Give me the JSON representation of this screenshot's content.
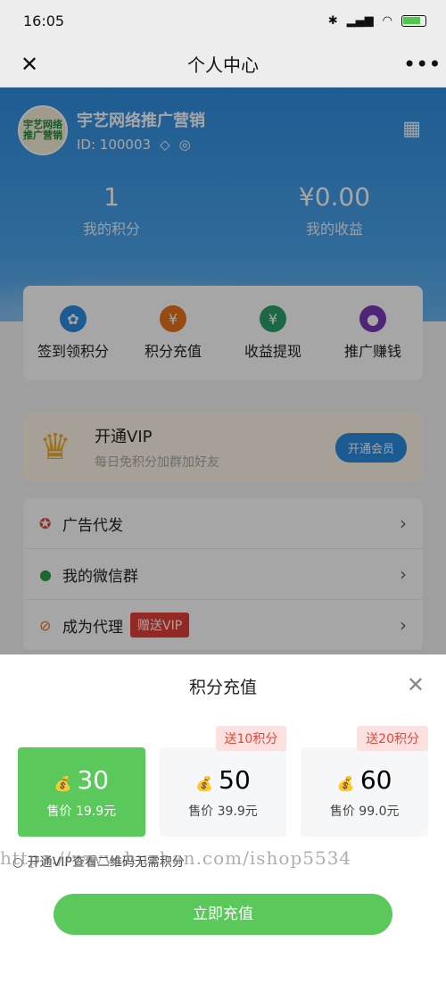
{
  "status": {
    "time": "16:05",
    "battery": "67"
  },
  "topbar": {
    "title": "个人中心"
  },
  "profile": {
    "name": "宇艺网络推广营销",
    "id": "ID: 100003",
    "avatar_text": "宇艺网络推广营销"
  },
  "stats": [
    {
      "value": "1",
      "label": "我的积分"
    },
    {
      "value": "¥0.00",
      "label": "我的收益"
    }
  ],
  "grid": [
    {
      "label": "签到领积分",
      "icon": "badge-icon",
      "color": "#2a8de0"
    },
    {
      "label": "积分充值",
      "icon": "yen-icon",
      "color": "#e8731e"
    },
    {
      "label": "收益提现",
      "icon": "money-bag-icon",
      "color": "#2aa06a"
    },
    {
      "label": "推广赚钱",
      "icon": "user-add-icon",
      "color": "#7a3ab8"
    }
  ],
  "vip": {
    "title": "开通VIP",
    "subtitle": "每日免积分加群加好友",
    "button": "开通会员"
  },
  "menu": [
    {
      "label": "广告代发",
      "icon": "award-icon"
    },
    {
      "label": "我的微信群",
      "icon": "wechat-icon"
    },
    {
      "label": "成为代理",
      "icon": "agent-icon",
      "tag": "赠送VIP"
    }
  ],
  "sheet": {
    "title": "积分充值",
    "cards": [
      {
        "amount": "30",
        "price": "售价 19.9元",
        "badge": "",
        "selected": true
      },
      {
        "amount": "50",
        "price": "售价 39.9元",
        "badge": "送10积分",
        "selected": false
      },
      {
        "amount": "60",
        "price": "售价 99.0元",
        "badge": "送20积分",
        "selected": false
      }
    ],
    "notice": "开通VIP查看二维码无需积分",
    "watermark": "https://www.huzhan.com/ishop5534",
    "button": "立即充值"
  }
}
